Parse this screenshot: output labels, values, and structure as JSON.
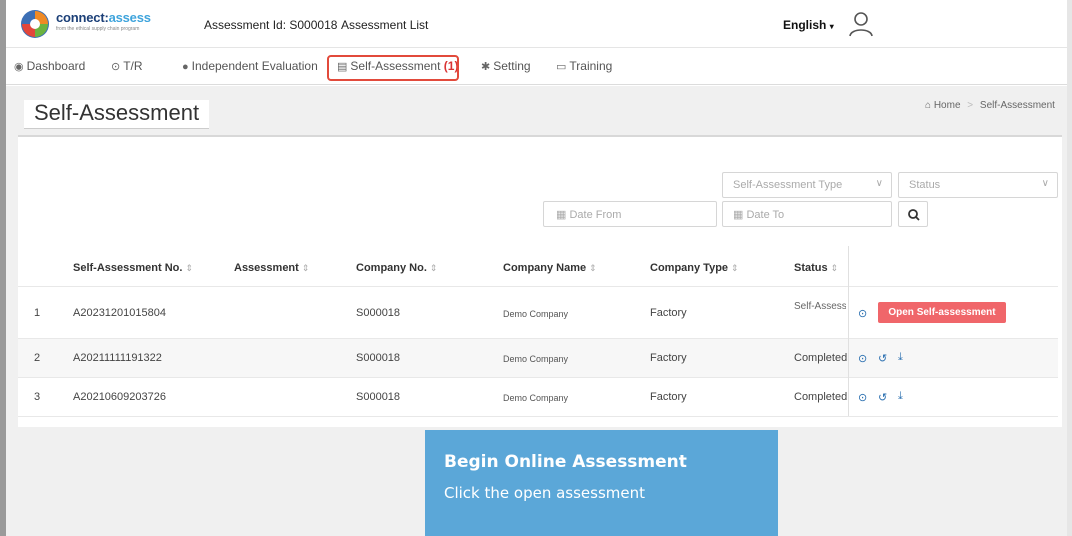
{
  "brand": {
    "name_prefix": "connect:",
    "name_suffix": "assess",
    "tagline": "from the ethical supply chain program"
  },
  "header": {
    "assessment_id": "Assessment Id: S000018",
    "assessment_list": "Assessment List",
    "language": "English",
    "language_caret": "▾"
  },
  "nav": {
    "dashboard": "Dashboard",
    "tr": "T/R",
    "independent_evaluation": "Independent Evaluation",
    "self_assessment": "Self-Assessment",
    "self_assessment_count": "(1)",
    "setting": "Setting",
    "training": "Training"
  },
  "page": {
    "title": "Self-Assessment",
    "breadcrumb_home": "Home",
    "breadcrumb_sep": ">",
    "breadcrumb_current": "Self-Assessment"
  },
  "filters": {
    "type_placeholder": "Self-Assessment Type",
    "status_placeholder": "Status",
    "date_from": "Date From",
    "date_to": "Date To"
  },
  "table": {
    "headers": [
      "Self-Assessment No.",
      "Assessment",
      "Company No.",
      "Company Name",
      "Company Type",
      "Status"
    ],
    "sort_glyph": "⇕",
    "rows": [
      {
        "index": "1",
        "no": "A20231201015804",
        "assessment": "",
        "company_no": "S000018",
        "company_name": "Demo Company",
        "company_type": "Factory",
        "status": "Self-Assessment editing"
      },
      {
        "index": "2",
        "no": "A20211111191322",
        "assessment": "",
        "company_no": "S000018",
        "company_name": "Demo Company",
        "company_type": "Factory",
        "status": "Completed"
      },
      {
        "index": "3",
        "no": "A20210609203726",
        "assessment": "",
        "company_no": "S000018",
        "company_name": "Demo Company",
        "company_type": "Factory",
        "status": "Completed"
      }
    ],
    "open_button": "Open Self-assessment"
  },
  "callout": {
    "title": "Begin Online Assessment",
    "body": "Click the open assessment"
  },
  "colors": {
    "accent_red": "#e24a3b",
    "open_button": "#f0666a",
    "callout_bg": "#5ba7d8",
    "brand_navy": "#1b3f77"
  }
}
